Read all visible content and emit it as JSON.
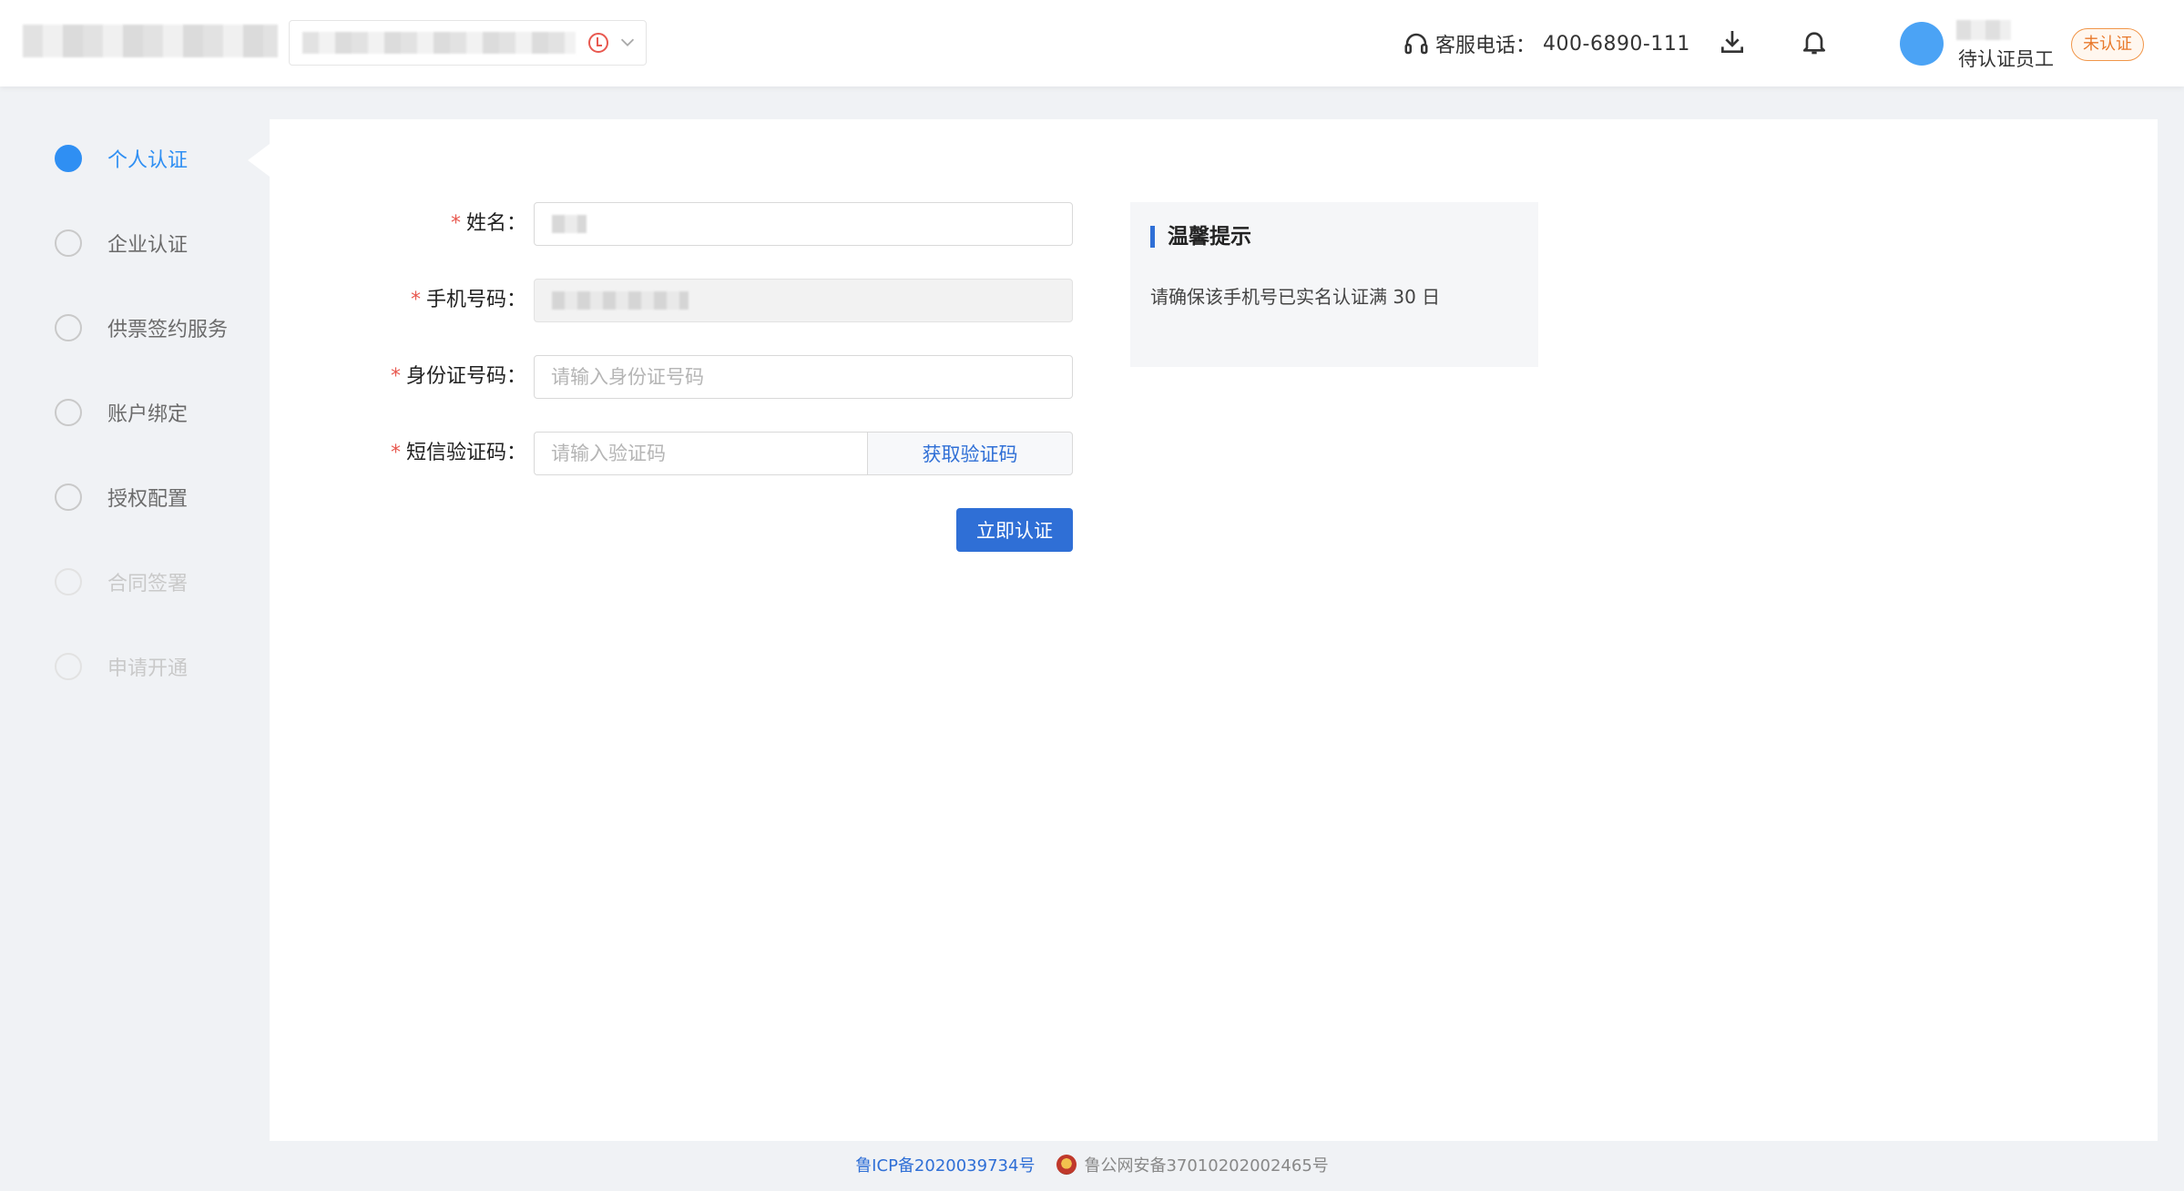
{
  "header": {
    "hotline_label": "客服电话：",
    "hotline_number": "400-6890-111",
    "user_role": "待认证员工",
    "verify_badge": "未认证",
    "icons": [
      "headset-icon",
      "download-icon",
      "bell-icon",
      "chevron-down-icon",
      "clock-alert-icon"
    ]
  },
  "sidebar": {
    "steps": [
      {
        "label": "个人认证",
        "state": "active"
      },
      {
        "label": "企业认证",
        "state": "pending"
      },
      {
        "label": "供票签约服务",
        "state": "pending"
      },
      {
        "label": "账户绑定",
        "state": "pending"
      },
      {
        "label": "授权配置",
        "state": "pending"
      },
      {
        "label": "合同签署",
        "state": "disabled"
      },
      {
        "label": "申请开通",
        "state": "disabled"
      }
    ]
  },
  "form": {
    "name": {
      "label": "姓名：",
      "required_mark": "*"
    },
    "phone": {
      "label": "手机号码：",
      "required_mark": "*"
    },
    "id_number": {
      "label": "身份证号码：",
      "required_mark": "*",
      "placeholder": "请输入身份证号码"
    },
    "sms_code": {
      "label": "短信验证码：",
      "required_mark": "*",
      "placeholder": "请输入验证码",
      "button": "获取验证码"
    },
    "submit": "立即认证"
  },
  "tips": {
    "title": "温馨提示",
    "text": "请确保该手机号已实名认证满 30 日"
  },
  "footer": {
    "icp": "鲁ICP备2020039734号",
    "police": "鲁公网安备37010202002465号"
  },
  "colors": {
    "primary": "#2f6fd6",
    "step_active": "#2f8ff3",
    "required": "#e8584f",
    "badge": "#e8792b"
  }
}
